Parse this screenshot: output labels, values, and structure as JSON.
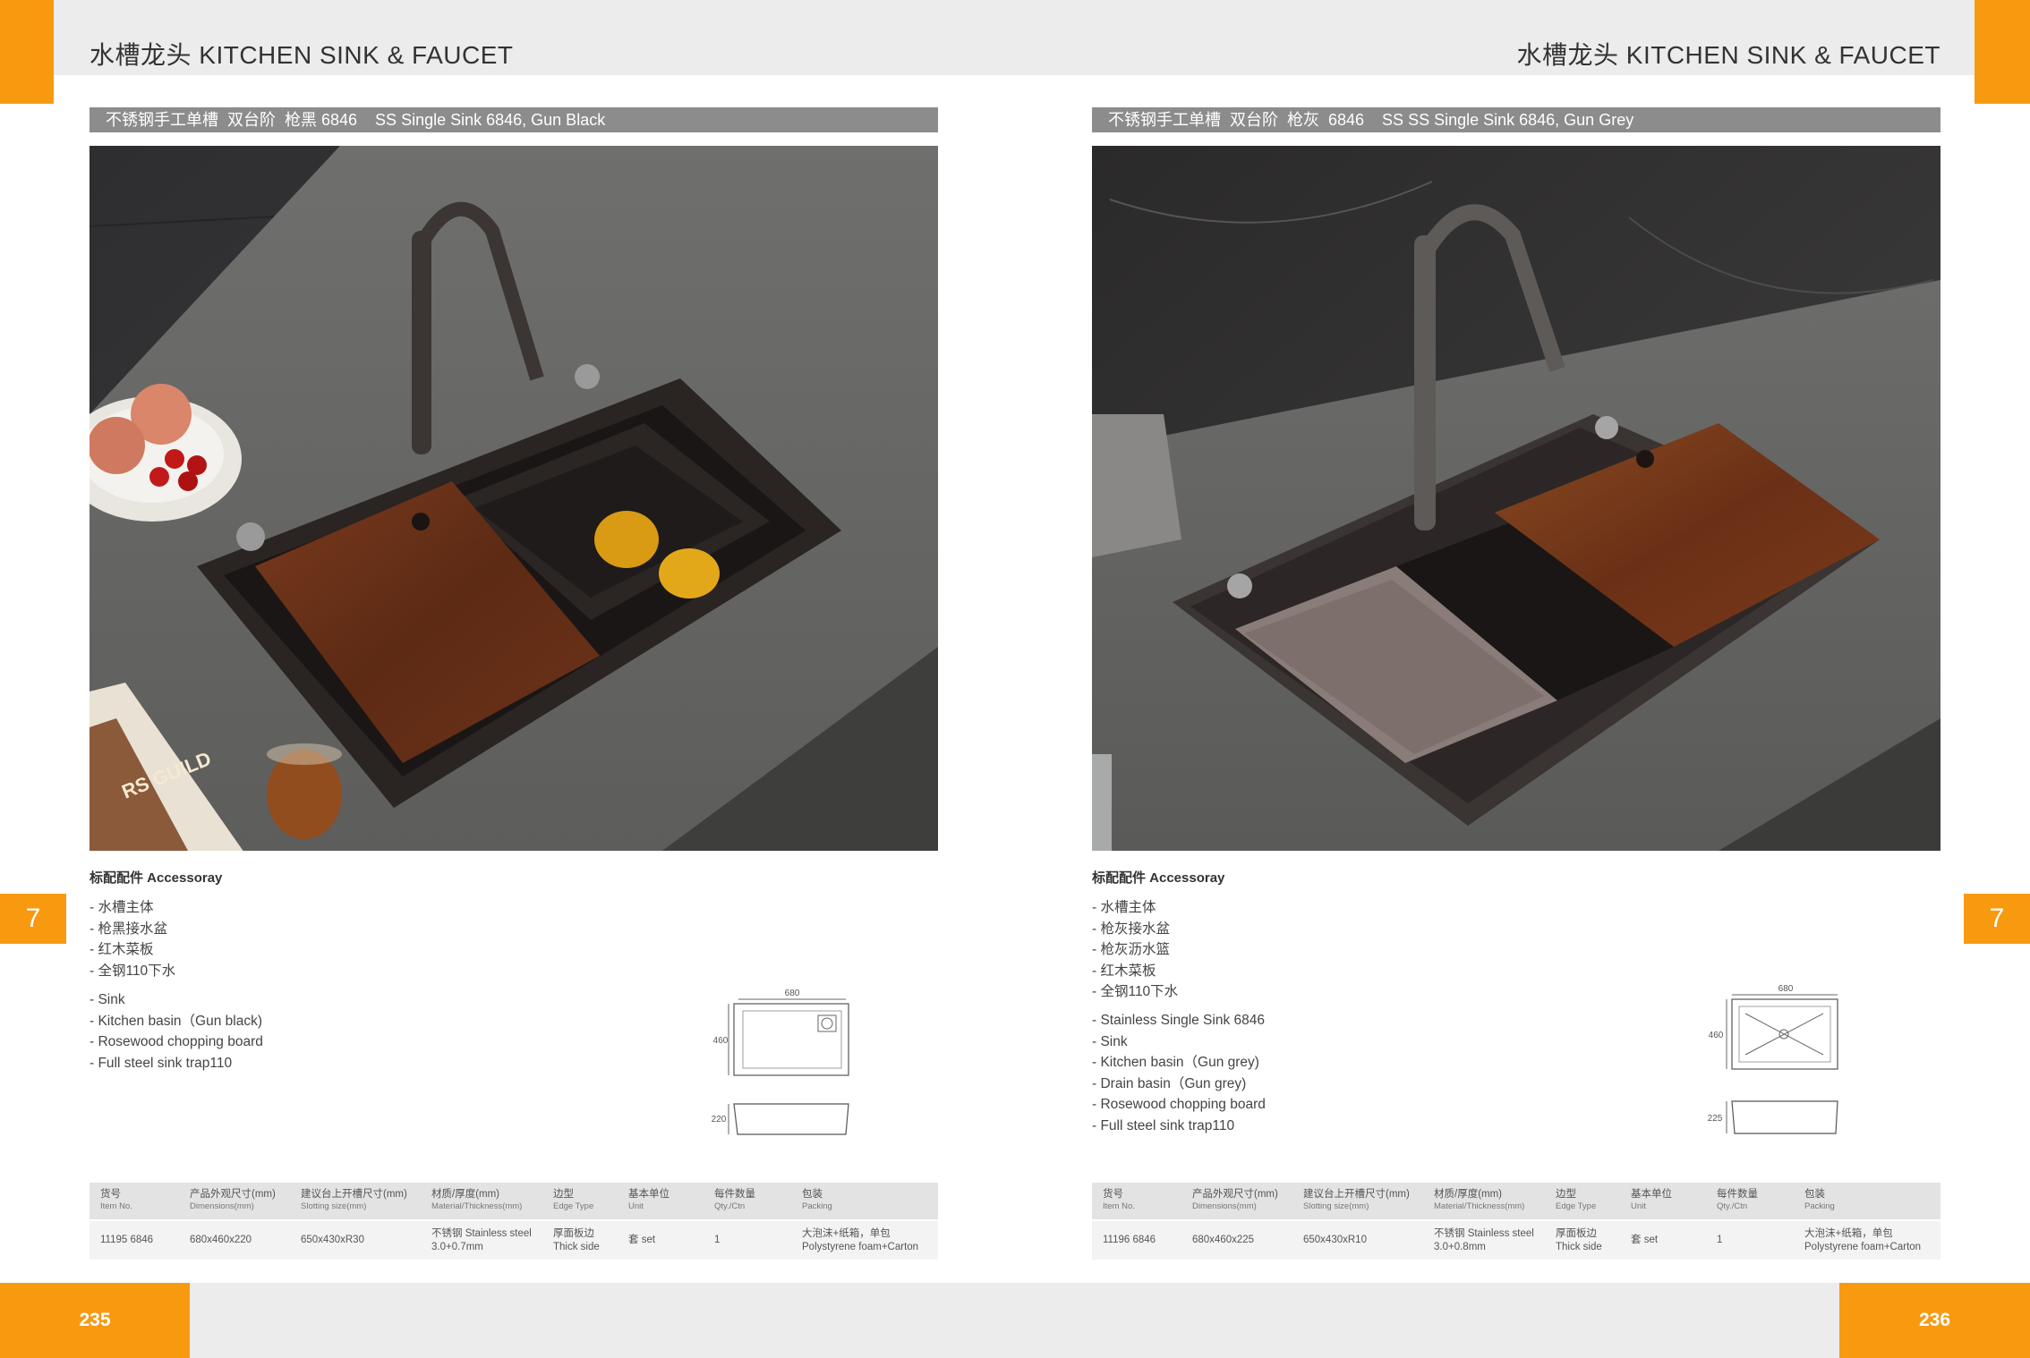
{
  "header": {
    "left_title": "水槽龙头 KITCHEN SINK & FAUCET",
    "right_title": "水槽龙头 KITCHEN SINK & FAUCET"
  },
  "left_page": {
    "product_title": "不锈钢手工单槽  双台阶  枪黑 6846    SS Single Sink 6846, Gun Black",
    "photo_book_text": "RS GUILD",
    "accessories_title": "标配配件 Accessoray",
    "accessories_cn": [
      "- 水槽主体",
      "- 枪黑接水盆",
      "- 红木菜板",
      "- 全钢110下水"
    ],
    "accessories_en": [
      "- Sink",
      "- Kitchen basin（Gun black)",
      "- Rosewood chopping board",
      "- Full steel sink trap110"
    ],
    "diagram": {
      "width": "680",
      "depth": "460",
      "height": "220"
    },
    "side_marker": "7",
    "page_number": "235",
    "table": {
      "headers": [
        {
          "cn": "货号",
          "en": "Item No."
        },
        {
          "cn": "产品外观尺寸(mm)",
          "en": "Dimensions(mm)"
        },
        {
          "cn": "建议台上开槽尺寸(mm)",
          "en": "Slotting size(mm)"
        },
        {
          "cn": "材质/厚度(mm)",
          "en": "Material/Thickness(mm)"
        },
        {
          "cn": "边型",
          "en": "Edge Type"
        },
        {
          "cn": "基本单位",
          "en": "Unit"
        },
        {
          "cn": "每件数量",
          "en": "Qty./Ctn"
        },
        {
          "cn": "包装",
          "en": "Packing"
        }
      ],
      "row": [
        {
          "l1": "11195 6846",
          "l2": ""
        },
        {
          "l1": "680x460x220",
          "l2": ""
        },
        {
          "l1": "650x430xR30",
          "l2": ""
        },
        {
          "l1": "不锈钢 Stainless steel",
          "l2": "3.0+0.7mm"
        },
        {
          "l1": "厚面板边",
          "l2": "Thick side"
        },
        {
          "l1": "套  set",
          "l2": ""
        },
        {
          "l1": "1",
          "l2": ""
        },
        {
          "l1": "大泡沫+纸箱，单包",
          "l2": "Polystyrene foam+Carton"
        }
      ]
    }
  },
  "right_page": {
    "product_title": "不锈钢手工单槽  双台阶  枪灰  6846    SS SS Single Sink 6846, Gun Grey",
    "accessories_title": "标配配件 Accessoray",
    "accessories_cn": [
      "- 水槽主体",
      "- 枪灰接水盆",
      "- 枪灰沥水篮",
      "- 红木菜板",
      "- 全钢110下水"
    ],
    "accessories_en": [
      "- Stainless Single Sink 6846",
      "- Sink",
      "- Kitchen basin（Gun grey)",
      "- Drain basin（Gun grey)",
      "- Rosewood chopping board",
      "- Full steel sink trap110"
    ],
    "diagram": {
      "width": "680",
      "depth": "460",
      "height": "225"
    },
    "side_marker": "7",
    "page_number": "236",
    "table": {
      "headers": [
        {
          "cn": "货号",
          "en": "Item No."
        },
        {
          "cn": "产品外观尺寸(mm)",
          "en": "Dimensions(mm)"
        },
        {
          "cn": "建议台上开槽尺寸(mm)",
          "en": "Slotting size(mm)"
        },
        {
          "cn": "材质/厚度(mm)",
          "en": "Material/Thickness(mm)"
        },
        {
          "cn": "边型",
          "en": "Edge Type"
        },
        {
          "cn": "基本单位",
          "en": "Unit"
        },
        {
          "cn": "每件数量",
          "en": "Qty./Ctn"
        },
        {
          "cn": "包装",
          "en": "Packing"
        }
      ],
      "row": [
        {
          "l1": "11196 6846",
          "l2": ""
        },
        {
          "l1": "680x460x225",
          "l2": ""
        },
        {
          "l1": "650x430xR10",
          "l2": ""
        },
        {
          "l1": "不锈钢 Stainless steel",
          "l2": "3.0+0.8mm"
        },
        {
          "l1": "厚面板边",
          "l2": "Thick side"
        },
        {
          "l1": "套  set",
          "l2": ""
        },
        {
          "l1": "1",
          "l2": ""
        },
        {
          "l1": "大泡沫+纸箱，单包",
          "l2": "Polystyrene foam+Carton"
        }
      ]
    }
  },
  "colors": {
    "accent": "#f79a10",
    "bar": "#8c8c8c",
    "band": "#ececec"
  }
}
